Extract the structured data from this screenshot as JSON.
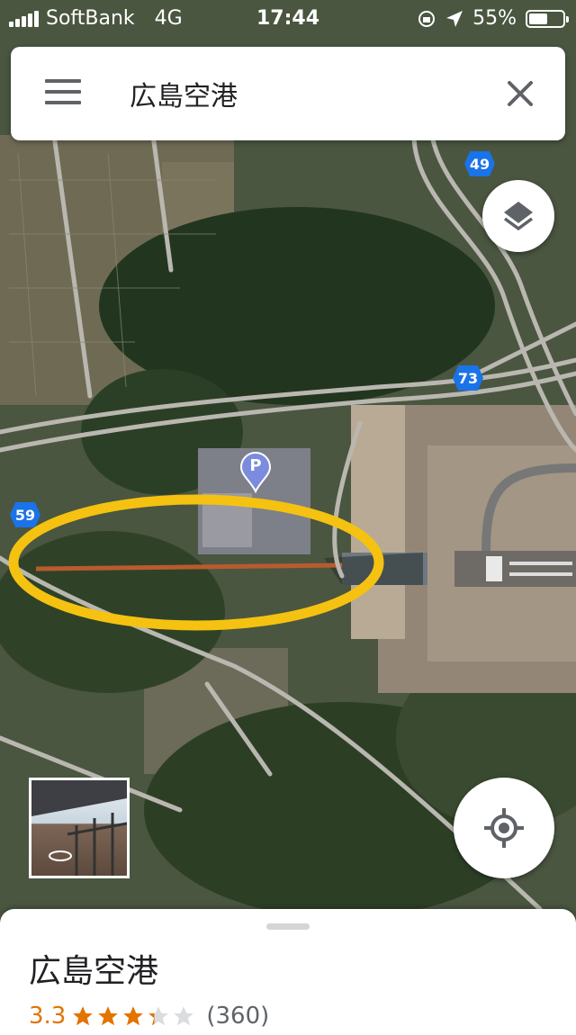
{
  "status_bar": {
    "carrier": "SoftBank",
    "network": "4G",
    "time": "17:44",
    "battery_percent": "55%",
    "battery_level": 0.55
  },
  "search": {
    "query": "広島空港",
    "menu_icon": "menu-icon",
    "clear_icon": "close-icon"
  },
  "map": {
    "route_badges": [
      "49",
      "73",
      "59"
    ],
    "parking_label": "P",
    "colors": {
      "highlight": "#f5c211",
      "route_badge": "#1a73e8",
      "parking_pin": "#7b8cde"
    }
  },
  "place": {
    "name": "広島空港",
    "rating": "3.3",
    "rating_value": 3.3,
    "reviews": "(360)",
    "star_color": "#e37400"
  }
}
